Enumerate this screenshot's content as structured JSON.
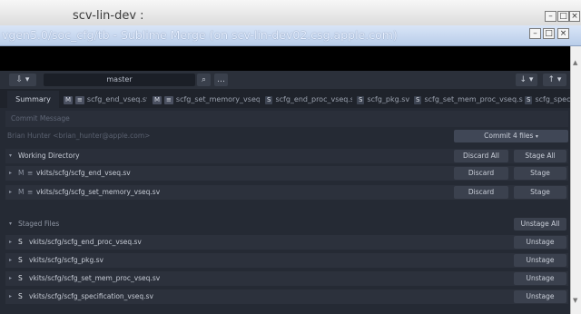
{
  "outer_window": {
    "title": "scv-lin-dev :"
  },
  "inner_window": {
    "title": "vgen5.0/soc_cfg/tb - Sublime Merge (on scv-lin-dev02.csg.apple.com)"
  },
  "toolbar": {
    "branch": "master"
  },
  "tabs": [
    {
      "label": "Summary",
      "badge": "",
      "active": true
    },
    {
      "label": "scfg_end_vseq.sv",
      "badge": "M",
      "active": false
    },
    {
      "label": "scfg_set_memory_vseq.sv",
      "badge": "M",
      "active": false
    },
    {
      "label": "scfg_end_proc_vseq.sv",
      "badge": "S",
      "active": false
    },
    {
      "label": "scfg_pkg.sv",
      "badge": "S",
      "active": false
    },
    {
      "label": "scfg_set_mem_proc_vseq.sv",
      "badge": "S",
      "active": false
    },
    {
      "label": "scfg_specifi",
      "badge": "S",
      "active": false
    }
  ],
  "commit": {
    "placeholder": "Commit Message",
    "author": "Brian Hunter <brian_hunter@apple.com>",
    "button": "Commit 4 files"
  },
  "working": {
    "title": "Working Directory",
    "discard_all": "Discard All",
    "stage_all": "Stage All",
    "files": [
      {
        "status": "M",
        "path": "vkits/scfg/scfg_end_vseq.sv",
        "discard": "Discard",
        "stage": "Stage"
      },
      {
        "status": "M",
        "path": "vkits/scfg/scfg_set_memory_vseq.sv",
        "discard": "Discard",
        "stage": "Stage"
      }
    ]
  },
  "staged": {
    "title": "Staged Files",
    "unstage_all": "Unstage All",
    "files": [
      {
        "status": "S",
        "path": "vkits/scfg/scfg_end_proc_vseq.sv",
        "unstage": "Unstage"
      },
      {
        "status": "S",
        "path": "vkits/scfg/scfg_pkg.sv",
        "unstage": "Unstage"
      },
      {
        "status": "S",
        "path": "vkits/scfg/scfg_set_mem_proc_vseq.sv",
        "unstage": "Unstage"
      },
      {
        "status": "S",
        "path": "vkits/scfg/scfg_specification_vseq.sv",
        "unstage": "Unstage"
      }
    ]
  }
}
